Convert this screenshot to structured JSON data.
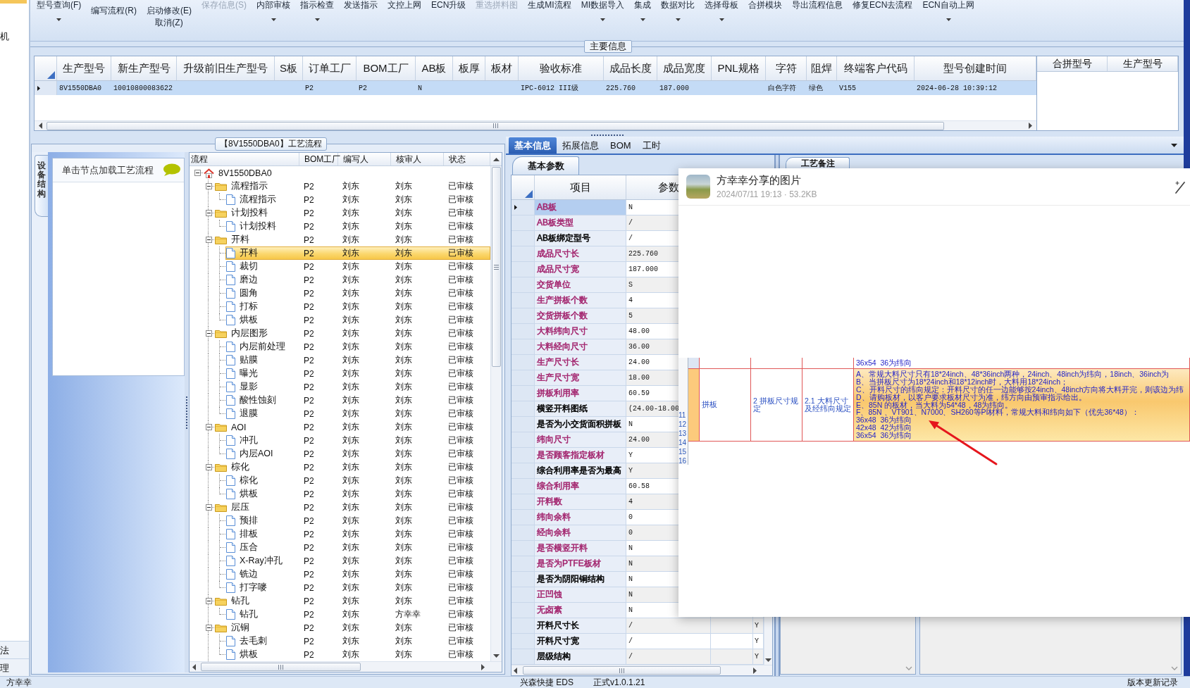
{
  "nav_strip": {
    "top_items": [
      "机"
    ],
    "bottom_items": [
      "法",
      "理"
    ]
  },
  "toolbar": {
    "items": [
      {
        "kind": "large",
        "label": "型号查询(F)",
        "disabled": false,
        "dropdown": true
      },
      {
        "kind": "stack",
        "labels": [
          "编写流程(R)"
        ]
      },
      {
        "kind": "stack",
        "labels": [
          "启动修改(E)",
          "取消(Z)"
        ]
      },
      {
        "kind": "large",
        "label": "保存信息(S)",
        "disabled": true,
        "dropdown": false
      },
      {
        "kind": "large",
        "label": "内部审核",
        "disabled": false,
        "dropdown": true
      },
      {
        "kind": "large",
        "label": "指示检查",
        "disabled": false,
        "dropdown": true
      },
      {
        "kind": "large",
        "label": "发送指示",
        "disabled": false,
        "dropdown": false
      },
      {
        "kind": "large",
        "label": "文控上网",
        "disabled": false,
        "dropdown": false
      },
      {
        "kind": "large",
        "label": "ECN升级",
        "disabled": false,
        "dropdown": false
      },
      {
        "kind": "large",
        "label": "重选拼料图",
        "disabled": true,
        "dropdown": false
      },
      {
        "kind": "large",
        "label": "生成MI流程",
        "disabled": false,
        "dropdown": false
      },
      {
        "kind": "large",
        "label": "MI数据导入",
        "disabled": false,
        "dropdown": true
      },
      {
        "kind": "large",
        "label": "集成",
        "disabled": false,
        "dropdown": true
      },
      {
        "kind": "large",
        "label": "数据对比",
        "disabled": false,
        "dropdown": true
      },
      {
        "kind": "large",
        "label": "选择母板",
        "disabled": false,
        "dropdown": true
      },
      {
        "kind": "large",
        "label": "合拼模块",
        "disabled": false,
        "dropdown": false
      },
      {
        "kind": "large",
        "label": "导出流程信息",
        "disabled": false,
        "dropdown": false
      },
      {
        "kind": "large",
        "label": "修复ECN去流程",
        "disabled": false,
        "dropdown": false
      },
      {
        "kind": "large",
        "label": "ECN自动上网",
        "disabled": false,
        "dropdown": true
      }
    ]
  },
  "main_info": {
    "title": "主要信息",
    "columns": [
      "生产型号",
      "新生产型号",
      "升级前旧生产型号",
      "S板",
      "订单工厂",
      "BOM工厂",
      "AB板",
      "板厚",
      "板材",
      "验收标准",
      "成品长度",
      "成品宽度",
      "PNL规格",
      "字符",
      "阻焊",
      "终端客户代码",
      "型号创建时间"
    ],
    "rows": [
      {
        "selected": true,
        "cells": [
          "8V1550DBA0",
          "10010800083622",
          null,
          null,
          "P2",
          "P2",
          "N",
          null,
          null,
          "IPC-6012 III级",
          "225.760",
          "187.000",
          null,
          "白色字符",
          "绿色",
          "V155",
          "2024-06-28 10:39:12"
        ]
      }
    ],
    "side_columns": [
      "合拼型号",
      "生产型号"
    ]
  },
  "process_flow": {
    "title": "【8V1550DBA0】工艺流程",
    "side_tabs": [
      {
        "label": "设备结构",
        "selected": true
      }
    ],
    "hint": "单击节点加载工艺流程",
    "tree": {
      "columns": [
        "流程",
        "BOM工厂",
        "编写人",
        "核审人",
        "状态"
      ],
      "nodes": [
        {
          "label": "8V1550DBA0",
          "kind": "root",
          "selected": false,
          "expanded": true,
          "children": [
            {
              "label": "流程指示",
              "kind": "folder",
              "factory": "P2",
              "author": "刘东",
              "reviewer": "刘东",
              "status": "已审核",
              "selected": false,
              "expanded": true,
              "children": [
                {
                  "label": "流程指示",
                  "kind": "step",
                  "factory": "P2",
                  "author": "刘东",
                  "reviewer": "刘东",
                  "status": "已审核",
                  "selected": false
                }
              ]
            },
            {
              "label": "计划投料",
              "kind": "folder",
              "factory": "P2",
              "author": "刘东",
              "reviewer": "刘东",
              "status": "已审核",
              "selected": false,
              "expanded": true,
              "children": [
                {
                  "label": "计划投料",
                  "kind": "step",
                  "factory": "P2",
                  "author": "刘东",
                  "reviewer": "刘东",
                  "status": "已审核",
                  "selected": false
                }
              ]
            },
            {
              "label": "开料",
              "kind": "folder",
              "factory": "P2",
              "author": "刘东",
              "reviewer": "刘东",
              "status": "已审核",
              "selected": false,
              "expanded": true,
              "children": [
                {
                  "label": "开料",
                  "kind": "step",
                  "factory": "P2",
                  "author": "刘东",
                  "reviewer": "刘东",
                  "status": "已审核",
                  "selected": true
                },
                {
                  "label": "裁切",
                  "kind": "step",
                  "factory": "P2",
                  "author": "刘东",
                  "reviewer": "刘东",
                  "status": "已审核",
                  "selected": false
                },
                {
                  "label": "磨边",
                  "kind": "step",
                  "factory": "P2",
                  "author": "刘东",
                  "reviewer": "刘东",
                  "status": "已审核",
                  "selected": false
                },
                {
                  "label": "圆角",
                  "kind": "step",
                  "factory": "P2",
                  "author": "刘东",
                  "reviewer": "刘东",
                  "status": "已审核",
                  "selected": false
                },
                {
                  "label": "打标",
                  "kind": "step",
                  "factory": "P2",
                  "author": "刘东",
                  "reviewer": "刘东",
                  "status": "已审核",
                  "selected": false
                },
                {
                  "label": "烘板",
                  "kind": "step",
                  "factory": "P2",
                  "author": "刘东",
                  "reviewer": "刘东",
                  "status": "已审核",
                  "selected": false
                }
              ]
            },
            {
              "label": "内层图形",
              "kind": "folder",
              "factory": "P2",
              "author": "刘东",
              "reviewer": "刘东",
              "status": "已审核",
              "selected": false,
              "expanded": true,
              "children": [
                {
                  "label": "内层前处理",
                  "kind": "step",
                  "factory": "P2",
                  "author": "刘东",
                  "reviewer": "刘东",
                  "status": "已审核",
                  "selected": false
                },
                {
                  "label": "贴膜",
                  "kind": "step",
                  "factory": "P2",
                  "author": "刘东",
                  "reviewer": "刘东",
                  "status": "已审核",
                  "selected": false
                },
                {
                  "label": "曝光",
                  "kind": "step",
                  "factory": "P2",
                  "author": "刘东",
                  "reviewer": "刘东",
                  "status": "已审核",
                  "selected": false
                },
                {
                  "label": "显影",
                  "kind": "step",
                  "factory": "P2",
                  "author": "刘东",
                  "reviewer": "刘东",
                  "status": "已审核",
                  "selected": false
                },
                {
                  "label": "酸性蚀刻",
                  "kind": "step",
                  "factory": "P2",
                  "author": "刘东",
                  "reviewer": "刘东",
                  "status": "已审核",
                  "selected": false
                },
                {
                  "label": "退膜",
                  "kind": "step",
                  "factory": "P2",
                  "author": "刘东",
                  "reviewer": "刘东",
                  "status": "已审核",
                  "selected": false
                }
              ]
            },
            {
              "label": "AOI",
              "kind": "folder",
              "factory": "P2",
              "author": "刘东",
              "reviewer": "刘东",
              "status": "已审核",
              "selected": false,
              "expanded": true,
              "children": [
                {
                  "label": "冲孔",
                  "kind": "step",
                  "factory": "P2",
                  "author": "刘东",
                  "reviewer": "刘东",
                  "status": "已审核",
                  "selected": false
                },
                {
                  "label": "内层AOI",
                  "kind": "step",
                  "factory": "P2",
                  "author": "刘东",
                  "reviewer": "刘东",
                  "status": "已审核",
                  "selected": false
                }
              ]
            },
            {
              "label": "棕化",
              "kind": "folder",
              "factory": "P2",
              "author": "刘东",
              "reviewer": "刘东",
              "status": "已审核",
              "selected": false,
              "expanded": true,
              "children": [
                {
                  "label": "棕化",
                  "kind": "step",
                  "factory": "P2",
                  "author": "刘东",
                  "reviewer": "刘东",
                  "status": "已审核",
                  "selected": false
                },
                {
                  "label": "烘板",
                  "kind": "step",
                  "factory": "P2",
                  "author": "刘东",
                  "reviewer": "刘东",
                  "status": "已审核",
                  "selected": false
                }
              ]
            },
            {
              "label": "层压",
              "kind": "folder",
              "factory": "P2",
              "author": "刘东",
              "reviewer": "刘东",
              "status": "已审核",
              "selected": false,
              "expanded": true,
              "children": [
                {
                  "label": "预排",
                  "kind": "step",
                  "factory": "P2",
                  "author": "刘东",
                  "reviewer": "刘东",
                  "status": "已审核",
                  "selected": false
                },
                {
                  "label": "排板",
                  "kind": "step",
                  "factory": "P2",
                  "author": "刘东",
                  "reviewer": "刘东",
                  "status": "已审核",
                  "selected": false
                },
                {
                  "label": "压合",
                  "kind": "step",
                  "factory": "P2",
                  "author": "刘东",
                  "reviewer": "刘东",
                  "status": "已审核",
                  "selected": false
                },
                {
                  "label": "X-Ray冲孔",
                  "kind": "step",
                  "factory": "P2",
                  "author": "刘东",
                  "reviewer": "刘东",
                  "status": "已审核",
                  "selected": false
                },
                {
                  "label": "铣边",
                  "kind": "step",
                  "factory": "P2",
                  "author": "刘东",
                  "reviewer": "刘东",
                  "status": "已审核",
                  "selected": false
                },
                {
                  "label": "打字嘜",
                  "kind": "step",
                  "factory": "P2",
                  "author": "刘东",
                  "reviewer": "刘东",
                  "status": "已审核",
                  "selected": false
                }
              ]
            },
            {
              "label": "钻孔",
              "kind": "folder",
              "factory": "P2",
              "author": "刘东",
              "reviewer": "刘东",
              "status": "已审核",
              "selected": false,
              "expanded": true,
              "children": [
                {
                  "label": "钻孔",
                  "kind": "step",
                  "factory": "P2",
                  "author": "刘东",
                  "reviewer": "方幸幸",
                  "status": "已审核",
                  "selected": false
                }
              ]
            },
            {
              "label": "沉铜",
              "kind": "folder",
              "factory": "P2",
              "author": "刘东",
              "reviewer": "刘东",
              "status": "已审核",
              "selected": false,
              "expanded": true,
              "children": [
                {
                  "label": "去毛刺",
                  "kind": "step",
                  "factory": "P2",
                  "author": "刘东",
                  "reviewer": "刘东",
                  "status": "已审核",
                  "selected": false
                },
                {
                  "label": "烘板",
                  "kind": "step",
                  "factory": "P2",
                  "author": "刘东",
                  "reviewer": "刘东",
                  "status": "已审核",
                  "selected": false
                }
              ]
            }
          ]
        }
      ]
    }
  },
  "details": {
    "tabs": [
      {
        "label": "基本信息",
        "selected": true
      },
      {
        "label": "拓展信息",
        "selected": false
      },
      {
        "label": "BOM",
        "selected": false
      },
      {
        "label": "工时",
        "selected": false
      }
    ],
    "params": {
      "tabs": [
        {
          "label": "基本参数",
          "selected": true
        }
      ],
      "columns": [
        "项目",
        "参数"
      ],
      "rows": [
        {
          "label": "AB板",
          "value": "N",
          "color": "#a3266f",
          "selected": true
        },
        {
          "label": "AB板类型",
          "value": "/",
          "color": "#a3266f",
          "selected": false
        },
        {
          "label": "AB板绑定型号",
          "value": "/",
          "color": "#000000",
          "selected": false
        },
        {
          "label": "成品尺寸长",
          "value": "225.760",
          "color": "#a3266f",
          "selected": false
        },
        {
          "label": "成品尺寸宽",
          "value": "187.000",
          "color": "#a3266f",
          "selected": false
        },
        {
          "label": "交货单位",
          "value": "S",
          "color": "#a3266f",
          "selected": false
        },
        {
          "label": "生产拼板个数",
          "value": "4",
          "color": "#a3266f",
          "selected": false
        },
        {
          "label": "交货拼板个数",
          "value": "5",
          "color": "#a3266f",
          "selected": false
        },
        {
          "label": "大料纬向尺寸",
          "value": "48.00",
          "color": "#a3266f",
          "selected": false
        },
        {
          "label": "大料经向尺寸",
          "value": "36.00",
          "color": "#a3266f",
          "selected": false
        },
        {
          "label": "生产尺寸长",
          "value": "24.00",
          "color": "#a3266f",
          "selected": false
        },
        {
          "label": "生产尺寸宽",
          "value": "18.00",
          "color": "#a3266f",
          "selected": false
        },
        {
          "label": "拼板利用率",
          "value": "60.59",
          "color": "#a3266f",
          "selected": false
        },
        {
          "label": "横竖开料图纸",
          "value": "(24.00-18.00",
          "color": "#000000",
          "selected": false
        },
        {
          "label": "是否为小交货面积拼板",
          "value": "N",
          "color": "#000000",
          "selected": false
        },
        {
          "label": "纬向尺寸",
          "value": "24.00",
          "color": "#a3266f",
          "selected": false
        },
        {
          "label": "是否顾客指定板材",
          "value": "Y",
          "color": "#a3266f",
          "selected": false
        },
        {
          "label": "综合利用率是否为最高",
          "value": "Y",
          "color": "#000000",
          "selected": false
        },
        {
          "label": "综合利用率",
          "value": "60.58",
          "color": "#a3266f",
          "selected": false
        },
        {
          "label": "开料数",
          "value": "4",
          "color": "#a3266f",
          "selected": false
        },
        {
          "label": "纬向余料",
          "value": "0",
          "color": "#a3266f",
          "selected": false
        },
        {
          "label": "经向余料",
          "value": "0",
          "color": "#a3266f",
          "selected": false
        },
        {
          "label": "是否横竖开料",
          "value": "N",
          "color": "#a3266f",
          "selected": false
        },
        {
          "label": "是否为PTFE板材",
          "value": "N",
          "color": "#a3266f",
          "selected": false
        },
        {
          "label": "是否为阴阳铜结构",
          "value": "N",
          "color": "#000000",
          "selected": false
        },
        {
          "label": "正凹蚀",
          "value": "N",
          "color": "#a3266f",
          "selected": false
        },
        {
          "label": "无卤素",
          "value": "N",
          "color": "#a3266f",
          "selected": false
        },
        {
          "label": "开料尺寸长",
          "value": "/",
          "flag": "Y",
          "color": "#000000",
          "selected": false
        },
        {
          "label": "开料尺寸宽",
          "value": "/",
          "flag": "Y",
          "color": "#000000",
          "selected": false
        },
        {
          "label": "层级结构",
          "value": "/",
          "flag": "Y",
          "color": "#000000",
          "selected": false
        }
      ]
    },
    "remarks": {
      "tabs": [
        {
          "label": "工艺备注",
          "selected": true
        }
      ]
    }
  },
  "image_viewer": {
    "title": "方幸幸分享的图片",
    "meta": "2024/07/11 19:13 · 53.2KB",
    "line_numbers": [
      "11",
      "12",
      "13",
      "14",
      "15",
      "16"
    ],
    "sheet_rows": [
      {
        "highlighted": false,
        "lines": [
          "36x54  36为纬向"
        ]
      },
      {
        "highlighted": true,
        "item": "拼板",
        "section": "2 拼板尺寸规定",
        "subsection": "2.1 大料尺寸及经纬向规定",
        "lines": [
          "A、常规大料尺寸只有18*24inch、48*36inch两种，24inch、48inch为纬向，18inch、36inch为",
          "B、当拼板尺寸为18*24inch和18*12inch时，大料用18*24inch；",
          "C、开料尺寸的纬向规定：开料尺寸的任一边能够按24inch、48inch方向将大料开完，则该边为纬",
          "D、请购板材，以客户要求板材尺寸为准，纬方向由预审指示给出。",
          "E、85N 的板材，当大料为54*48，48为纬向。",
          "F、85N 、VT901、N7000、SH260等PI材料，常规大料和纬向如下（优先36*48）：",
          "36x48  36为纬向",
          "42x48  42为纬向",
          "36x54  36为纬向"
        ]
      }
    ]
  },
  "status_bar": {
    "user": "方幸幸",
    "product": "兴森快捷 EDS",
    "version": "正式v1.0.1.21",
    "link": "版本更新记录"
  }
}
